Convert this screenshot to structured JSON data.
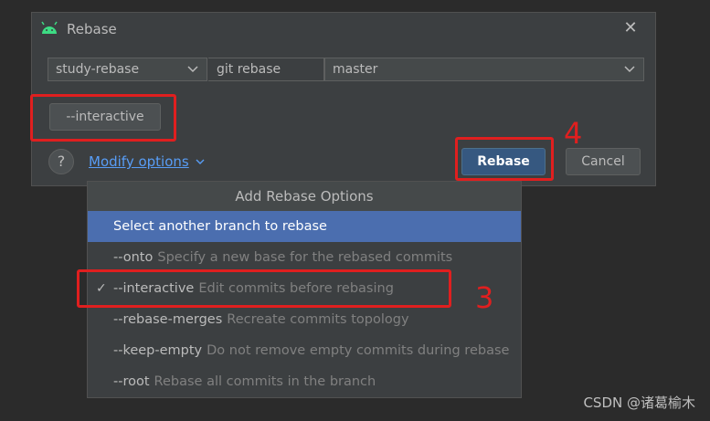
{
  "dialog": {
    "title": "Rebase",
    "close_symbol": "✕",
    "branch_value": "study-rebase",
    "command_label": "git rebase",
    "upstream_value": "master",
    "interactive_chip": "--interactive",
    "help_symbol": "?",
    "modify_options": "Modify options",
    "rebase_button": "Rebase",
    "cancel_button": "Cancel"
  },
  "popup": {
    "header": "Add Rebase Options",
    "options": [
      {
        "flag": "Select another branch to rebase",
        "desc": "",
        "checked": false,
        "selected": true
      },
      {
        "flag": "--onto",
        "desc": "Specify a new base for the rebased commits",
        "checked": false,
        "selected": false
      },
      {
        "flag": "--interactive",
        "desc": "Edit commits before rebasing",
        "checked": true,
        "selected": false
      },
      {
        "flag": "--rebase-merges",
        "desc": "Recreate commits topology",
        "checked": false,
        "selected": false
      },
      {
        "flag": "--keep-empty",
        "desc": "Do not remove empty commits during rebase",
        "checked": false,
        "selected": false
      },
      {
        "flag": "--root",
        "desc": "Rebase all commits in the branch",
        "checked": false,
        "selected": false
      }
    ],
    "check_symbol": "✓"
  },
  "annotations": {
    "step3": "3",
    "step4": "4",
    "color": "#e01f1f"
  },
  "watermark": "CSDN @诸葛榆木",
  "colors": {
    "background": "#2b2b2b",
    "dialog": "#3c3f41",
    "accent_blue": "#4b6eaf",
    "primary_button": "#365880",
    "link": "#589df6"
  }
}
